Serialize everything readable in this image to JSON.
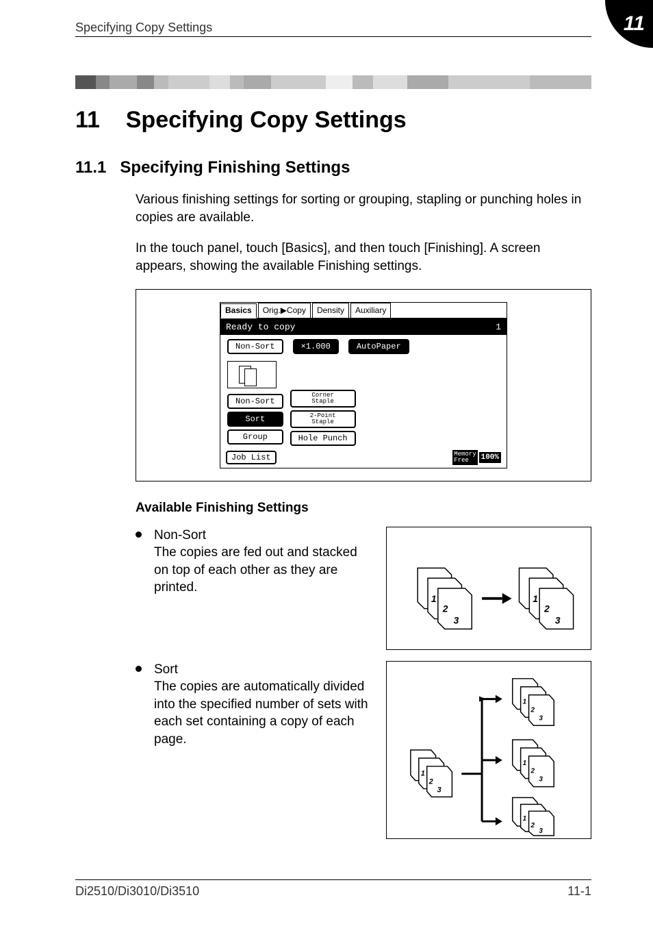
{
  "header": {
    "running_title": "Specifying Copy Settings",
    "corner_number": "11"
  },
  "divider_colors": [
    "#555",
    "#888",
    "#aaa",
    "#888",
    "#bbb",
    "#ccc",
    "#ddd",
    "#bbb",
    "#aaa",
    "#ccc",
    "#eee",
    "#bbb",
    "#ddd",
    "#aaa",
    "#ccc",
    "#bbb"
  ],
  "chapter": {
    "number": "11",
    "title": "Specifying Copy Settings"
  },
  "section": {
    "number": "11.1",
    "title": "Specifying Finishing Settings"
  },
  "paragraphs": {
    "p1": "Various finishing settings for sorting or grouping, stapling or punching holes in copies are available.",
    "p2": "In the touch panel, touch [Basics], and then touch [Finishing]. A screen appears, showing the available Finishing settings."
  },
  "touch_panel": {
    "tabs": [
      "Basics",
      "Orig.▶Copy",
      "Density",
      "Auxiliary"
    ],
    "status_text": "Ready to copy",
    "status_count": "1",
    "top_row": {
      "left": "Non-Sort",
      "mid": "×1.000",
      "right": "AutoPaper"
    },
    "left_col": [
      "Non-Sort",
      "Sort",
      "Group"
    ],
    "right_col": [
      "Corner\nStaple",
      "2-Point\nStaple",
      "Hole Punch"
    ],
    "footer_left": "Job List",
    "footer_right_label": "Memory\nFree",
    "footer_right_value": "100%"
  },
  "sub_heading": "Available Finishing Settings",
  "bullets": [
    {
      "title": "Non-Sort",
      "desc": "The copies are fed out and stacked on top of each other as they are printed."
    },
    {
      "title": "Sort",
      "desc": "The copies are automatically divided into the specified number of sets with each set containing a copy of each page."
    }
  ],
  "footer": {
    "left": "Di2510/Di3010/Di3510",
    "right": "11-1"
  }
}
